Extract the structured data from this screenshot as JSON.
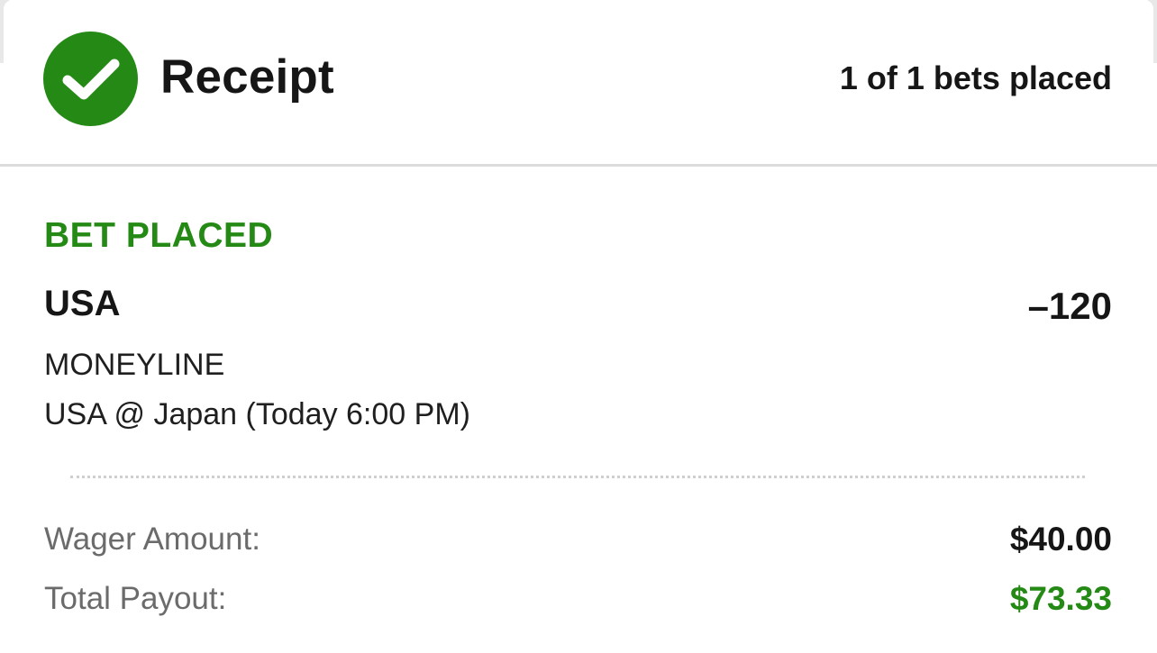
{
  "header": {
    "title": "Receipt",
    "bets_placed": "1 of 1 bets placed",
    "status_icon": "check-circle-icon"
  },
  "bet": {
    "status": "BET PLACED",
    "selection": "USA",
    "odds": "–120",
    "market": "MONEYLINE",
    "event": "USA @ Japan (Today 6:00 PM)"
  },
  "summary": {
    "wager_label": "Wager Amount:",
    "wager_value": "$40.00",
    "payout_label": "Total Payout:",
    "payout_value": "$73.33"
  },
  "colors": {
    "accent_green": "#248a15",
    "text_dark": "#161616",
    "text_muted": "#6b6b6b",
    "divider": "#dcdcdc"
  }
}
